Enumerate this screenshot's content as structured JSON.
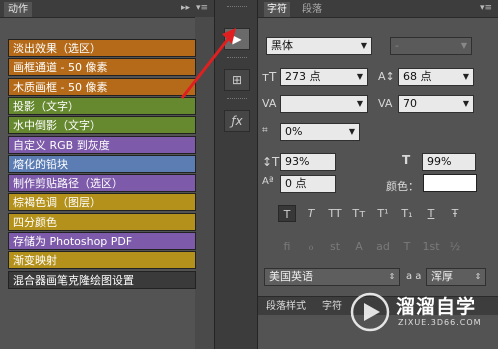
{
  "actions_panel": {
    "tab": "动作",
    "menu_icon": "menu-icon",
    "collapse_icon": "double-chevron-right-icon",
    "items": [
      {
        "label": "淡出效果（选区）",
        "color": "#b46a18"
      },
      {
        "label": "画框通道 - 50 像素",
        "color": "#b46a18"
      },
      {
        "label": "木质画框 - 50 像素",
        "color": "#b46a18"
      },
      {
        "label": "投影（文字）",
        "color": "#66882f"
      },
      {
        "label": "水中倒影（文字）",
        "color": "#66882f"
      },
      {
        "label": "自定义 RGB 到灰度",
        "color": "#7d5aaa"
      },
      {
        "label": "熔化的铅块",
        "color": "#5b7db4"
      },
      {
        "label": "制作剪贴路径（选区）",
        "color": "#7d5aaa"
      },
      {
        "label": "棕褐色调（图层）",
        "color": "#b3911b"
      },
      {
        "label": "四分颜色",
        "color": "#b3911b"
      },
      {
        "label": "存储为 Photoshop PDF",
        "color": "#7d5aaa"
      },
      {
        "label": "渐变映射",
        "color": "#b3911b"
      },
      {
        "label": "混合器画笔克隆绘图设置",
        "color": "#3a3a3a"
      }
    ]
  },
  "toolbar": {
    "buttons": [
      "play-icon",
      "grid-icon",
      "fx-icon"
    ]
  },
  "character_panel": {
    "tabs": [
      "字符",
      "段落"
    ],
    "font_family": "黑体",
    "font_style": "-",
    "font_size": "273 点",
    "leading": "68 点",
    "kerning": "",
    "tracking": "70",
    "scale_percent": "0%",
    "vertical_scale": "93%",
    "horizontal_scale": "99%",
    "baseline_shift": "0 点",
    "color_label": "颜色：",
    "text_color": "#ffffff",
    "style_buttons": [
      "T",
      "T",
      "TT",
      "Tт",
      "T¹",
      "T₁",
      "T",
      "Ŧ"
    ],
    "opentype_buttons": [
      "fi",
      "ℴ",
      "st",
      "A",
      "ad",
      "T",
      "1st",
      "½"
    ],
    "language": "美国英语",
    "aa_label": "a a",
    "antialias": "浑厚",
    "bottom_tabs": [
      "段落样式",
      "字符"
    ]
  },
  "watermark": {
    "title": "溜溜自学",
    "url": "ZIXUE.3D66.COM"
  }
}
